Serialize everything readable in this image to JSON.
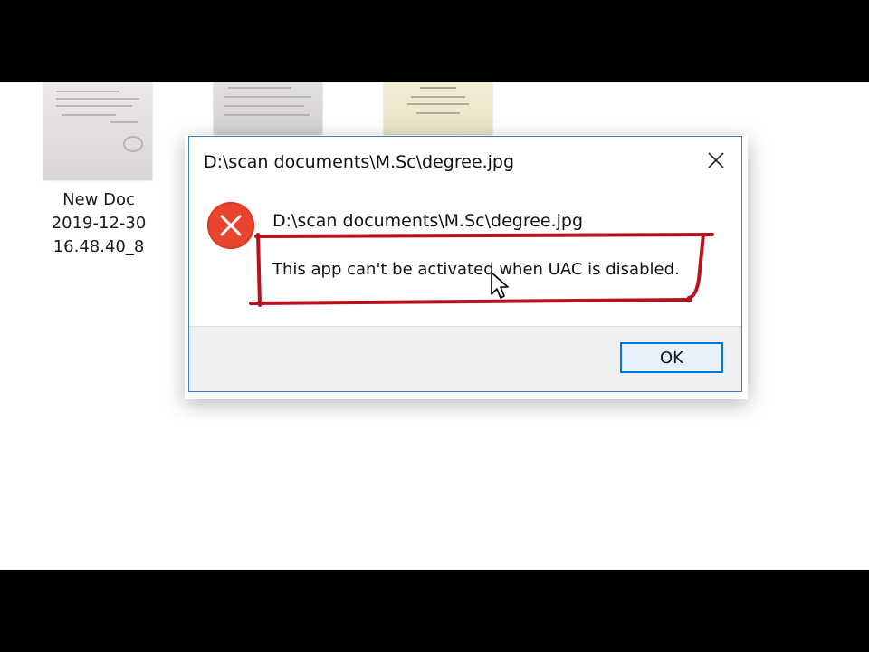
{
  "desktop": {
    "file": {
      "name_line1": "New Doc",
      "name_line2": "2019-12-30",
      "name_line3": "16.48.40_8"
    }
  },
  "dialog": {
    "title": "D:\\scan documents\\M.Sc\\degree.jpg",
    "icon": "error-icon",
    "message_path": "D:\\scan documents\\M.Sc\\degree.jpg",
    "message": "This app can't be activated when UAC is disabled.",
    "ok_label": "OK",
    "close_icon": "close-icon"
  },
  "colors": {
    "error_red": "#e8442f",
    "annotation_red": "#b5121b",
    "accent_blue": "#0078d7",
    "dialog_border": "#3f7ecb"
  }
}
